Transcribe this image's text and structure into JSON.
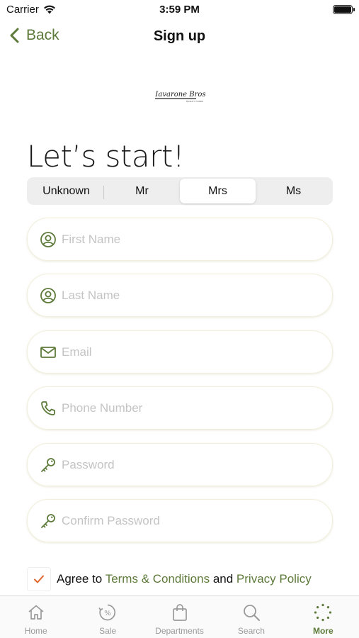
{
  "status_bar": {
    "carrier": "Carrier",
    "time": "3:59 PM"
  },
  "nav": {
    "back_label": "Back",
    "title": "Sign up"
  },
  "logo": {
    "text": "Iavarone Bros",
    "subtext": "QUALITY FOODS"
  },
  "heading": "Let’s start!",
  "title_segments": {
    "options": [
      "Unknown",
      "Mr",
      "Mrs",
      "Ms"
    ],
    "selected": "Mrs"
  },
  "form": {
    "first_name_placeholder": "First Name",
    "last_name_placeholder": "Last Name",
    "email_placeholder": "Email",
    "phone_placeholder": "Phone Number",
    "password_placeholder": "Password",
    "confirm_password_placeholder": "Confirm Password"
  },
  "agree": {
    "checked": true,
    "prefix": "Agree to",
    "terms": "Terms & Conditions",
    "conjunction": "and",
    "privacy": "Privacy Policy"
  },
  "tabbar": {
    "items": [
      {
        "label": "Home",
        "icon": "home-icon"
      },
      {
        "label": "Sale",
        "icon": "sale-icon"
      },
      {
        "label": "Departments",
        "icon": "bag-icon"
      },
      {
        "label": "Search",
        "icon": "search-icon"
      },
      {
        "label": "More",
        "icon": "more-icon"
      }
    ],
    "active": "More"
  },
  "colors": {
    "accent": "#5d7a3a",
    "check": "#e2672b",
    "field_border": "#f1efdc"
  }
}
